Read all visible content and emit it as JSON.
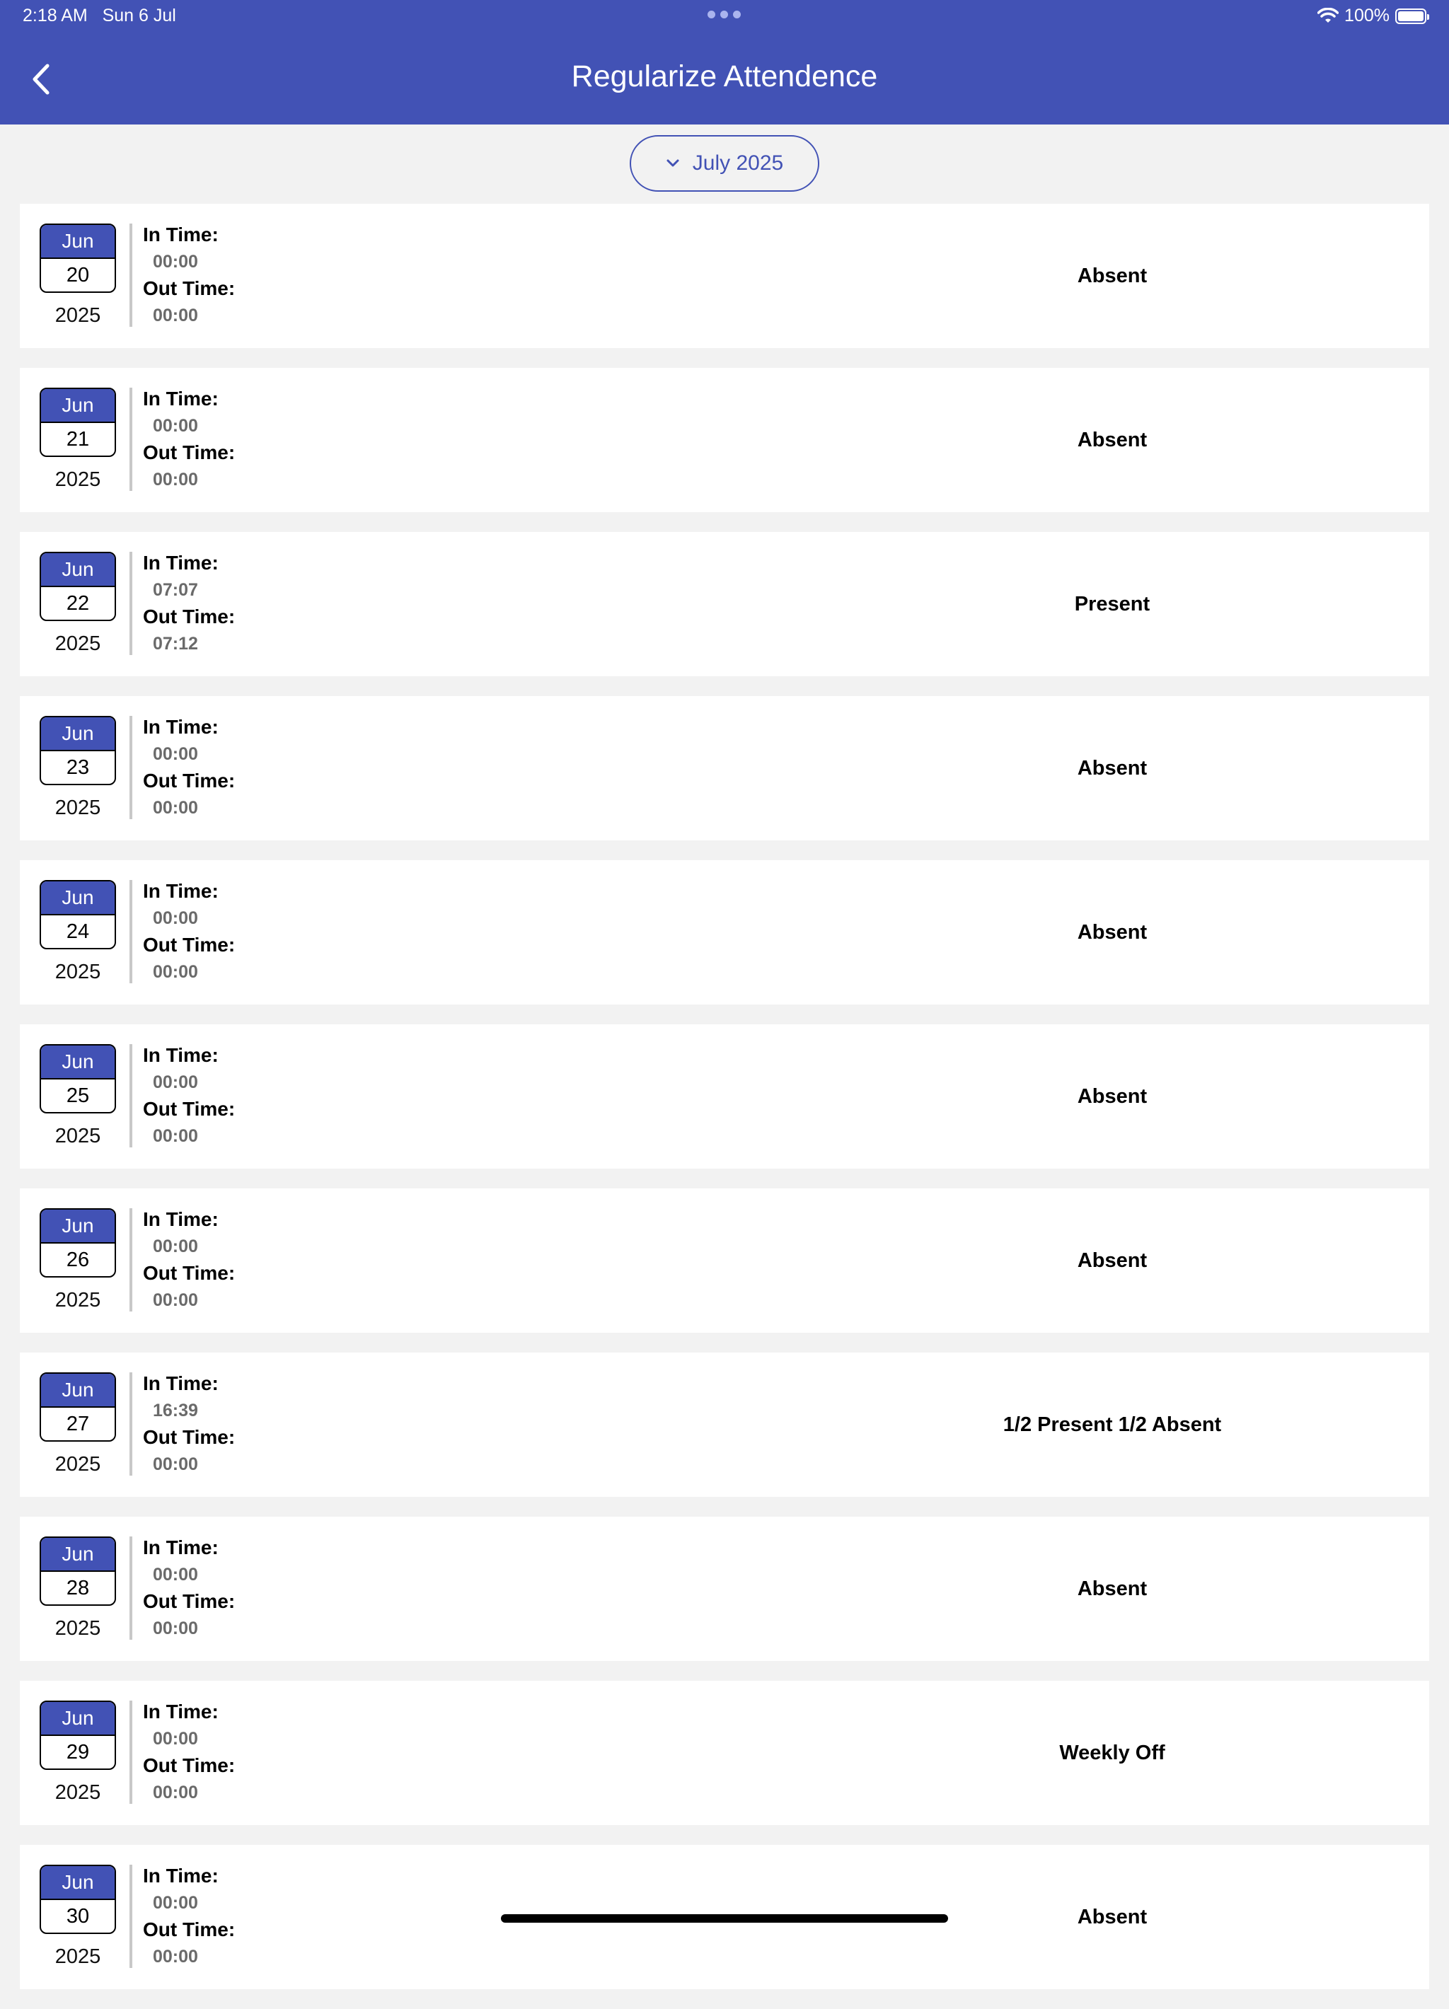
{
  "status_bar": {
    "time": "2:18 AM",
    "date": "Sun 6 Jul",
    "battery": "100%"
  },
  "header": {
    "title": "Regularize Attendence"
  },
  "month_selector": {
    "label": "July 2025"
  },
  "labels": {
    "in_time": "In Time:",
    "out_time": "Out Time:"
  },
  "rows": [
    {
      "month": "Jun",
      "day": "20",
      "year": "2025",
      "in_time": "00:00",
      "out_time": "00:00",
      "status": "Absent"
    },
    {
      "month": "Jun",
      "day": "21",
      "year": "2025",
      "in_time": "00:00",
      "out_time": "00:00",
      "status": "Absent"
    },
    {
      "month": "Jun",
      "day": "22",
      "year": "2025",
      "in_time": "07:07",
      "out_time": "07:12",
      "status": "Present"
    },
    {
      "month": "Jun",
      "day": "23",
      "year": "2025",
      "in_time": "00:00",
      "out_time": "00:00",
      "status": "Absent"
    },
    {
      "month": "Jun",
      "day": "24",
      "year": "2025",
      "in_time": "00:00",
      "out_time": "00:00",
      "status": "Absent"
    },
    {
      "month": "Jun",
      "day": "25",
      "year": "2025",
      "in_time": "00:00",
      "out_time": "00:00",
      "status": "Absent"
    },
    {
      "month": "Jun",
      "day": "26",
      "year": "2025",
      "in_time": "00:00",
      "out_time": "00:00",
      "status": "Absent"
    },
    {
      "month": "Jun",
      "day": "27",
      "year": "2025",
      "in_time": "16:39",
      "out_time": "00:00",
      "status": "1/2 Present 1/2 Absent"
    },
    {
      "month": "Jun",
      "day": "28",
      "year": "2025",
      "in_time": "00:00",
      "out_time": "00:00",
      "status": "Absent"
    },
    {
      "month": "Jun",
      "day": "29",
      "year": "2025",
      "in_time": "00:00",
      "out_time": "00:00",
      "status": "Weekly Off"
    },
    {
      "month": "Jun",
      "day": "30",
      "year": "2025",
      "in_time": "00:00",
      "out_time": "00:00",
      "status": "Absent"
    }
  ],
  "colors": {
    "primary": "#4252b5",
    "background": "#f2f2f2",
    "card": "#ffffff"
  },
  "icons": {
    "back": "chevron-left-icon",
    "dropdown": "chevron-down-icon",
    "wifi": "wifi-icon",
    "battery": "battery-icon"
  }
}
